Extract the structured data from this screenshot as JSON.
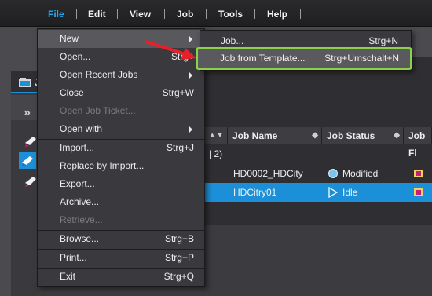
{
  "menubar": {
    "items": [
      {
        "label": "File"
      },
      {
        "label": "Edit"
      },
      {
        "label": "View"
      },
      {
        "label": "Job"
      },
      {
        "label": "Tools"
      },
      {
        "label": "Help"
      }
    ]
  },
  "window": {
    "title": "J",
    "expand_glyph": "»"
  },
  "table": {
    "columns": [
      {
        "label": ""
      },
      {
        "label": "Job Name"
      },
      {
        "label": "Job Status"
      },
      {
        "label": "Job Fl"
      }
    ],
    "group_label": "| 2)",
    "rows": [
      {
        "name": "HD0002_HDCity",
        "status": "Modified",
        "status_icon": "circle-icon"
      },
      {
        "name": "HDCitry01",
        "status": "Idle",
        "status_icon": "play-icon"
      }
    ]
  },
  "file_menu": {
    "items": [
      {
        "label": "New",
        "shortcut": "",
        "submenu": true,
        "disabled": false
      },
      {
        "label": "Open...",
        "shortcut": "Strg+",
        "submenu": false,
        "disabled": false
      },
      {
        "label": "Open Recent Jobs",
        "shortcut": "",
        "submenu": true,
        "disabled": false
      },
      {
        "label": "Close",
        "shortcut": "Strg+W",
        "submenu": false,
        "disabled": false
      },
      {
        "label": "Open Job Ticket...",
        "shortcut": "",
        "submenu": false,
        "disabled": true
      },
      {
        "label": "Open with",
        "shortcut": "",
        "submenu": true,
        "disabled": false
      },
      {
        "label": "Import...",
        "shortcut": "Strg+J",
        "submenu": false,
        "disabled": false
      },
      {
        "label": "Replace by Import...",
        "shortcut": "",
        "submenu": false,
        "disabled": false
      },
      {
        "label": "Export...",
        "shortcut": "",
        "submenu": false,
        "disabled": false
      },
      {
        "label": "Archive...",
        "shortcut": "",
        "submenu": false,
        "disabled": false
      },
      {
        "label": "Retrieve...",
        "shortcut": "",
        "submenu": false,
        "disabled": true
      },
      {
        "label": "Browse...",
        "shortcut": "Strg+B",
        "submenu": false,
        "disabled": false
      },
      {
        "label": "Print...",
        "shortcut": "Strg+P",
        "submenu": false,
        "disabled": false
      },
      {
        "label": "Exit",
        "shortcut": "Strg+Q",
        "submenu": false,
        "disabled": false
      }
    ]
  },
  "new_submenu": {
    "items": [
      {
        "label": "Job...",
        "shortcut": "Strg+N"
      },
      {
        "label": "Job from Template...",
        "shortcut": "Strg+Umschalt+N"
      }
    ]
  },
  "colors": {
    "accent": "#25a7f0",
    "highlight_border": "#8bd24a",
    "callout_arrow": "#e8202a",
    "selection": "#1c8fd9"
  }
}
